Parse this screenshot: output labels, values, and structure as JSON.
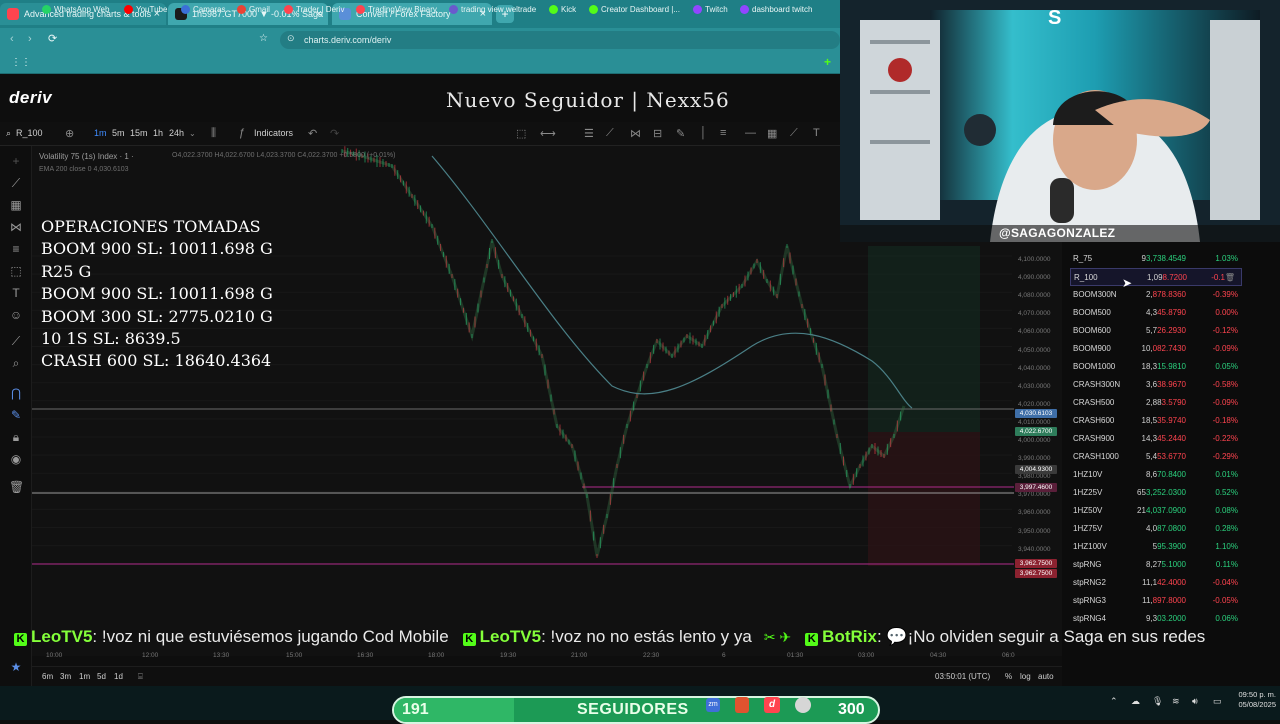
{
  "browser": {
    "tabs": [
      {
        "title": "Advanced trading charts & tools",
        "color": "#ffffff",
        "active": true
      },
      {
        "title": "1h5987.GT7000 ▼ -0.01% Saga",
        "color": "#ffffff",
        "active": false
      },
      {
        "title": "Convert / Forex Factory",
        "color": "#5a8fd8",
        "active": false
      }
    ],
    "url": "charts.deriv.com/deriv",
    "bookmarks": [
      {
        "label": "WhatsApp Web",
        "color": "#25d366"
      },
      {
        "label": "YouTube",
        "color": "#ff0000"
      },
      {
        "label": "Camaras",
        "color": "#3b6fd8"
      },
      {
        "label": "Gmail",
        "color": "#ea4335"
      },
      {
        "label": "Trader | Deriv",
        "color": "#ff444f"
      },
      {
        "label": "TradingView Binary",
        "color": "#ff444f"
      },
      {
        "label": "trading view weltrade",
        "color": "#6a5acd"
      },
      {
        "label": "Kick",
        "color": "#53fc18"
      },
      {
        "label": "Creator Dashboard |...",
        "color": "#53fc18"
      },
      {
        "label": "Twitch",
        "color": "#9146ff"
      },
      {
        "label": "dashboard twitch",
        "color": "#9146ff"
      }
    ]
  },
  "header": {
    "logo": "deriv",
    "overlay_title": "Nuevo Seguidor | Nexx56"
  },
  "toolbar": {
    "symbol": "R_100",
    "timeframes": [
      "1m",
      "5m",
      "15m",
      "1h",
      "24h"
    ],
    "active_timeframe": "1m",
    "indicators_label": "Indicators"
  },
  "chart": {
    "instrument": "Volatility 75 (1s) Index · 1 ·",
    "ohlc": "O4,022.3700 H4,022.6700 L4,023.3700 C4,022.3700 +0.5800 (+0.01%)",
    "ema": "EMA 200 close 0   4,030.6103",
    "operations": [
      "OPERACIONES TOMADAS",
      "BOOM 900 SL: 10011.698 G",
      "R25 G",
      "BOOM 900 SL: 10011.698 G",
      "BOOM 300 SL: 2775.0210 G",
      "10 1S SL: 8639.5",
      "CRASH 600 SL: 18640.4364"
    ],
    "price_axis": [
      "4,100.0000",
      "4,090.0000",
      "4,080.0000",
      "4,070.0000",
      "4,060.0000",
      "4,050.0000",
      "4,040.0000",
      "4,030.0000",
      "4,020.0000",
      "4,010.0000",
      "4,000.0000",
      "3,990.0000",
      "3,980.0000",
      "3,970.0000",
      "3,960.0000",
      "3,950.0000",
      "3,940.0000"
    ],
    "badges": [
      {
        "text": "4,030.6103",
        "color": "#3f6fa8"
      },
      {
        "text": "4,022.6700",
        "color": "#2e7d5b"
      },
      {
        "text": "4,004.9300",
        "color": "#3a3a3a"
      },
      {
        "text": "3,997.4600",
        "color": "#5a1f3a"
      },
      {
        "text": "3,962.7500",
        "color": "#8c2230"
      },
      {
        "text": "3,962.7500",
        "color": "#8c2230"
      }
    ],
    "time_axis": [
      "10:00",
      "12:00",
      "13:30",
      "15:00",
      "16:30",
      "18:00",
      "19:30",
      "21:00",
      "22:30",
      "6",
      "01:30",
      "03:00",
      "04:30",
      "06:0"
    ]
  },
  "bottom": {
    "ranges": [
      "6m",
      "3m",
      "1m",
      "5d",
      "1d"
    ],
    "time_utc": "03:50:01 (UTC)",
    "scale": [
      "%",
      "log",
      "auto"
    ]
  },
  "webcam": {
    "tag": "@SAGAGONZALEZ"
  },
  "watchlist": [
    {
      "symbol": "R_75",
      "price_a": "9",
      "price_b": "3,738.4549",
      "change": "1.03%",
      "up": true
    },
    {
      "symbol": "R_100",
      "price_a": "1,09",
      "price_b": "8.7200",
      "change": "-0.1",
      "up": false,
      "selected": true
    },
    {
      "symbol": "BOOM300N",
      "price_a": "2,",
      "price_b": "878.8360",
      "change": "-0.39%",
      "up": false
    },
    {
      "symbol": "BOOM500",
      "price_a": "4,3",
      "price_b": "45.8790",
      "change": "0.00%",
      "up": false
    },
    {
      "symbol": "BOOM600",
      "price_a": "5,7",
      "price_b": "26.2930",
      "change": "-0.12%",
      "up": false
    },
    {
      "symbol": "BOOM900",
      "price_a": "10,",
      "price_b": "082.7430",
      "change": "-0.09%",
      "up": false
    },
    {
      "symbol": "BOOM1000",
      "price_a": "18,3",
      "price_b": "15.9810",
      "change": "0.05%",
      "up": true
    },
    {
      "symbol": "CRASH300N",
      "price_a": "3,6",
      "price_b": "38.9670",
      "change": "-0.58%",
      "up": false
    },
    {
      "symbol": "CRASH500",
      "price_a": "2,88",
      "price_b": "3.5790",
      "change": "-0.09%",
      "up": false
    },
    {
      "symbol": "CRASH600",
      "price_a": "18,5",
      "price_b": "35.9740",
      "change": "-0.18%",
      "up": false
    },
    {
      "symbol": "CRASH900",
      "price_a": "14,3",
      "price_b": "45.2440",
      "change": "-0.22%",
      "up": false
    },
    {
      "symbol": "CRASH1000",
      "price_a": "5,4",
      "price_b": "53.6770",
      "change": "-0.29%",
      "up": false
    },
    {
      "symbol": "1HZ10V",
      "price_a": "8,6",
      "price_b": "70.8400",
      "change": "0.01%",
      "up": true
    },
    {
      "symbol": "1HZ25V",
      "price_a": "65",
      "price_b": "3,252.0300",
      "change": "0.52%",
      "up": true
    },
    {
      "symbol": "1HZ50V",
      "price_a": "21",
      "price_b": "4,037.0900",
      "change": "0.08%",
      "up": true
    },
    {
      "symbol": "1HZ75V",
      "price_a": "4,0",
      "price_b": "87.0800",
      "change": "0.28%",
      "up": true
    },
    {
      "symbol": "1HZ100V",
      "price_a": "5",
      "price_b": "95.3900",
      "change": "1.10%",
      "up": true
    },
    {
      "symbol": "stpRNG",
      "price_a": "8,27",
      "price_b": "5.1000",
      "change": "0.11%",
      "up": true
    },
    {
      "symbol": "stpRNG2",
      "price_a": "11,1",
      "price_b": "42.4000",
      "change": "-0.04%",
      "up": false
    },
    {
      "symbol": "stpRNG3",
      "price_a": "11,",
      "price_b": "897.8000",
      "change": "-0.05%",
      "up": false
    },
    {
      "symbol": "stpRNG4",
      "price_a": "9,3",
      "price_b": "03.2000",
      "change": "0.06%",
      "up": true
    }
  ],
  "chat": [
    {
      "user": "LeoTV5",
      "msg": ": !voz ni que estuviésemos jugando Cod Mobile"
    },
    {
      "user": "LeoTV5",
      "msg": ": !voz no no estás lento y ya"
    },
    {
      "user": "BotRix",
      "msg": ": 💬¡No olviden seguir a Saga en sus redes"
    }
  ],
  "followers": {
    "current": "191",
    "label": "SEGUIDORES",
    "goal": "300"
  },
  "clock": {
    "time": "09:50 p. m.",
    "date": "05/08/2025"
  },
  "colors": {
    "up": "#2bd17e",
    "down": "#ff444f",
    "chrome": "#2a8f96"
  }
}
